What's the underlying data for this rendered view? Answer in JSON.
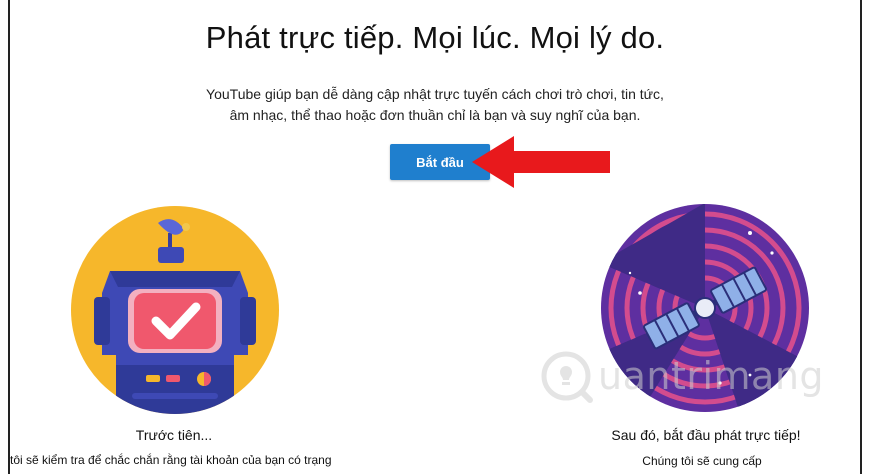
{
  "hero": {
    "title": "Phát trực tiếp. Mọi lúc. Mọi lý do.",
    "subtitle_line1": "YouTube giúp bạn dễ dàng cập nhật trực tuyến cách chơi trò chơi, tin tức,",
    "subtitle_line2": "âm nhạc, thể thao hoặc đơn thuần chỉ là bạn và suy nghĩ của bạn.",
    "start_button": "Bắt đầu"
  },
  "steps": {
    "left_caption": "Trước tiên...",
    "left_detail": "tôi sẽ kiểm tra để chắc chắn rằng tài khoản của bạn có trạng",
    "right_caption": "Sau đó, bắt đầu phát trực tiếp!",
    "right_detail": "Chúng tôi sẽ cung cấp"
  },
  "watermark": {
    "text": "uantrimang"
  },
  "colors": {
    "button": "#1f7fce",
    "arrow": "#e8191c",
    "left_circle": "#f6b72b",
    "robot_body": "#3e49b5",
    "screen": "#f0586d",
    "right_circle": "#5e2fa0"
  }
}
